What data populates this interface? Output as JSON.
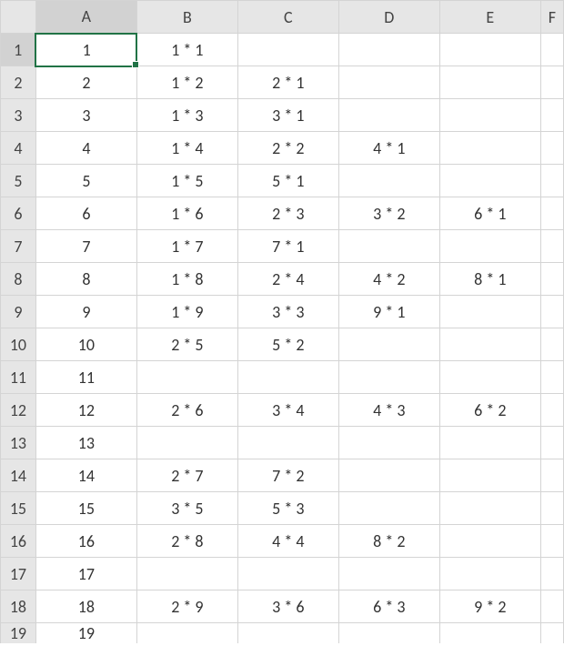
{
  "columns": [
    "A",
    "B",
    "C",
    "D",
    "E",
    "F"
  ],
  "visible_rows": 19,
  "active_cell": {
    "row": 1,
    "col": "A"
  },
  "cells": {
    "r1": {
      "A": "1",
      "B": "1 * 1"
    },
    "r2": {
      "A": "2",
      "B": "1 * 2",
      "C": "2 * 1"
    },
    "r3": {
      "A": "3",
      "B": "1 * 3",
      "C": "3 * 1"
    },
    "r4": {
      "A": "4",
      "B": "1 * 4",
      "C": "2 * 2",
      "D": "4 * 1"
    },
    "r5": {
      "A": "5",
      "B": "1 * 5",
      "C": "5 * 1"
    },
    "r6": {
      "A": "6",
      "B": "1 * 6",
      "C": "2 * 3",
      "D": "3 * 2",
      "E": "6 * 1"
    },
    "r7": {
      "A": "7",
      "B": "1 * 7",
      "C": "7 * 1"
    },
    "r8": {
      "A": "8",
      "B": "1 * 8",
      "C": "2 * 4",
      "D": "4 * 2",
      "E": "8 * 1"
    },
    "r9": {
      "A": "9",
      "B": "1 * 9",
      "C": "3 * 3",
      "D": "9 * 1"
    },
    "r10": {
      "A": "10",
      "B": "2 * 5",
      "C": "5 * 2"
    },
    "r11": {
      "A": "11"
    },
    "r12": {
      "A": "12",
      "B": "2 * 6",
      "C": "3 * 4",
      "D": "4 * 3",
      "E": "6 * 2"
    },
    "r13": {
      "A": "13"
    },
    "r14": {
      "A": "14",
      "B": "2 * 7",
      "C": "7 * 2"
    },
    "r15": {
      "A": "15",
      "B": "3 * 5",
      "C": "5 * 3"
    },
    "r16": {
      "A": "16",
      "B": "2 * 8",
      "C": "4 * 4",
      "D": "8 * 2"
    },
    "r17": {
      "A": "17"
    },
    "r18": {
      "A": "18",
      "B": "2 * 9",
      "C": "3 * 6",
      "D": "6 * 3",
      "E": "9 * 2"
    },
    "r19": {
      "A": "19"
    }
  }
}
